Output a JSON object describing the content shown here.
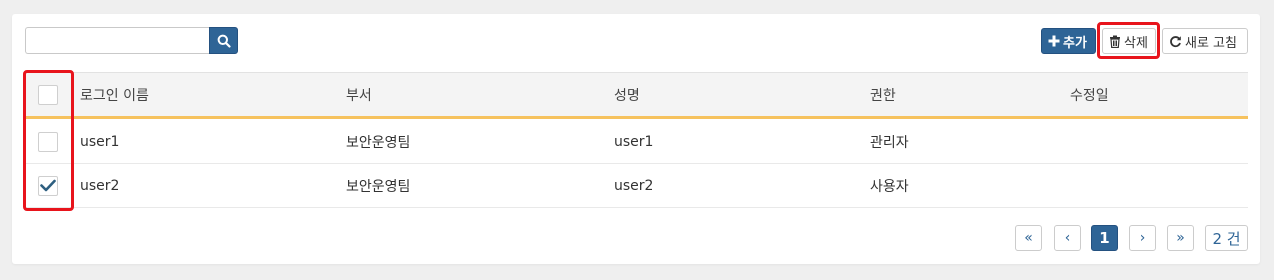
{
  "search": {
    "placeholder": ""
  },
  "toolbar": {
    "add_label": "추가",
    "delete_label": "삭제",
    "refresh_label": "새로 고침"
  },
  "table": {
    "headers": [
      "로그인 이름",
      "부서",
      "성명",
      "권한",
      "수정일"
    ],
    "rows": [
      {
        "login": "user1",
        "dept": "보안운영팀",
        "name": "user1",
        "role": "관리자",
        "modified": "",
        "checked": false
      },
      {
        "login": "user2",
        "dept": "보안운영팀",
        "name": "user2",
        "role": "사용자",
        "modified": "",
        "checked": true
      }
    ]
  },
  "pagination": {
    "first": "«",
    "prev": "‹",
    "current": "1",
    "next": "›",
    "last": "»",
    "total": "2 건"
  },
  "colors": {
    "primary": "#2e6496",
    "highlight": "#e8141c",
    "header_rule": "#f6c25e"
  },
  "icons": {
    "search": "search-icon",
    "add": "plus-icon",
    "delete": "trash-icon",
    "refresh": "refresh-icon",
    "check": "check-icon"
  }
}
